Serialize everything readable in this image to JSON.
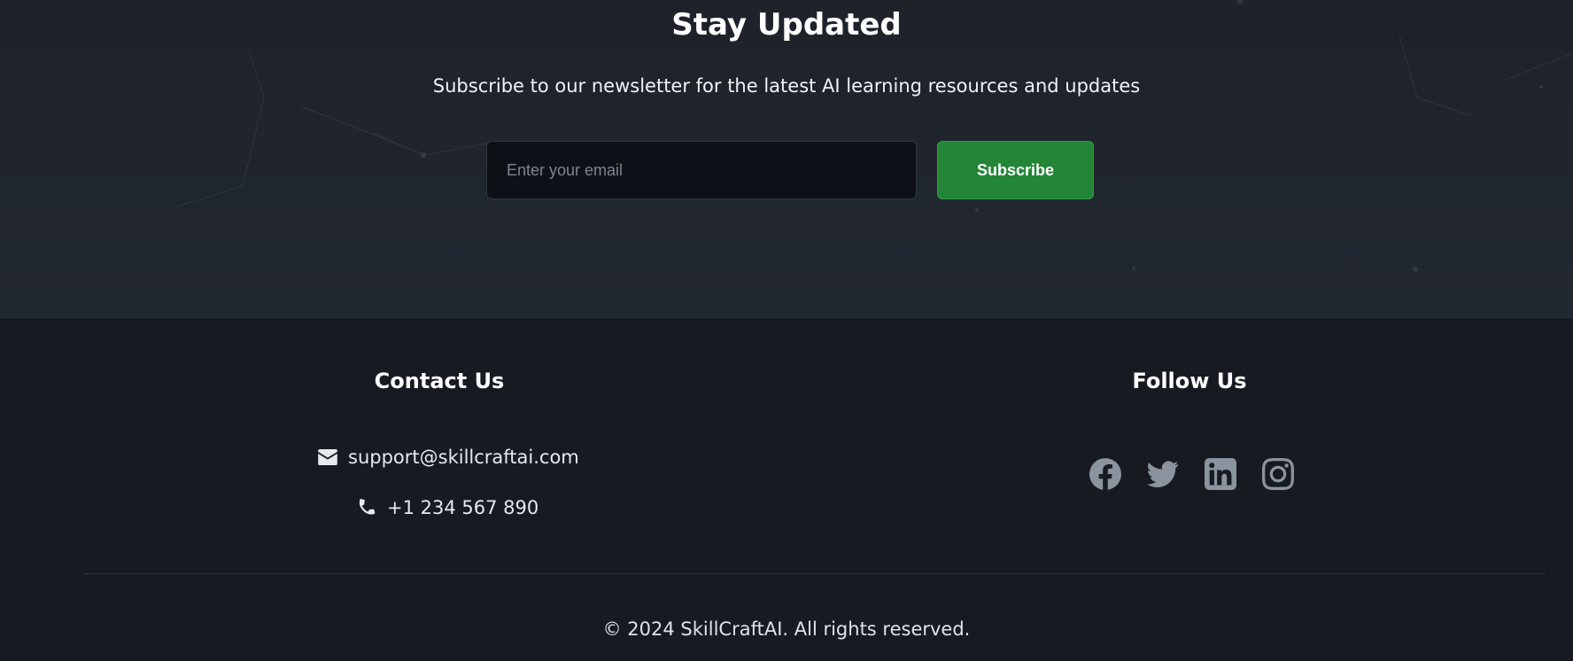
{
  "newsletter": {
    "title": "Stay Updated",
    "subtitle": "Subscribe to our newsletter for the latest AI learning resources and updates",
    "email_placeholder": "Enter your email",
    "email_value": "",
    "subscribe_label": "Subscribe"
  },
  "footer": {
    "contact": {
      "title": "Contact Us",
      "email": "support@skillcraftai.com",
      "phone": "+1 234 567 890",
      "email_icon": "envelope-icon",
      "phone_icon": "phone-icon"
    },
    "follow": {
      "title": "Follow Us",
      "socials": [
        "facebook-icon",
        "twitter-icon",
        "linkedin-icon",
        "instagram-icon"
      ]
    },
    "copyright": "© 2024 SkillCraftAI. All rights reserved."
  },
  "colors": {
    "accent_green": "#238636",
    "background_dark": "#171b21",
    "newsletter_bg": "#1e2229",
    "icon_gray": "#8b949e"
  }
}
